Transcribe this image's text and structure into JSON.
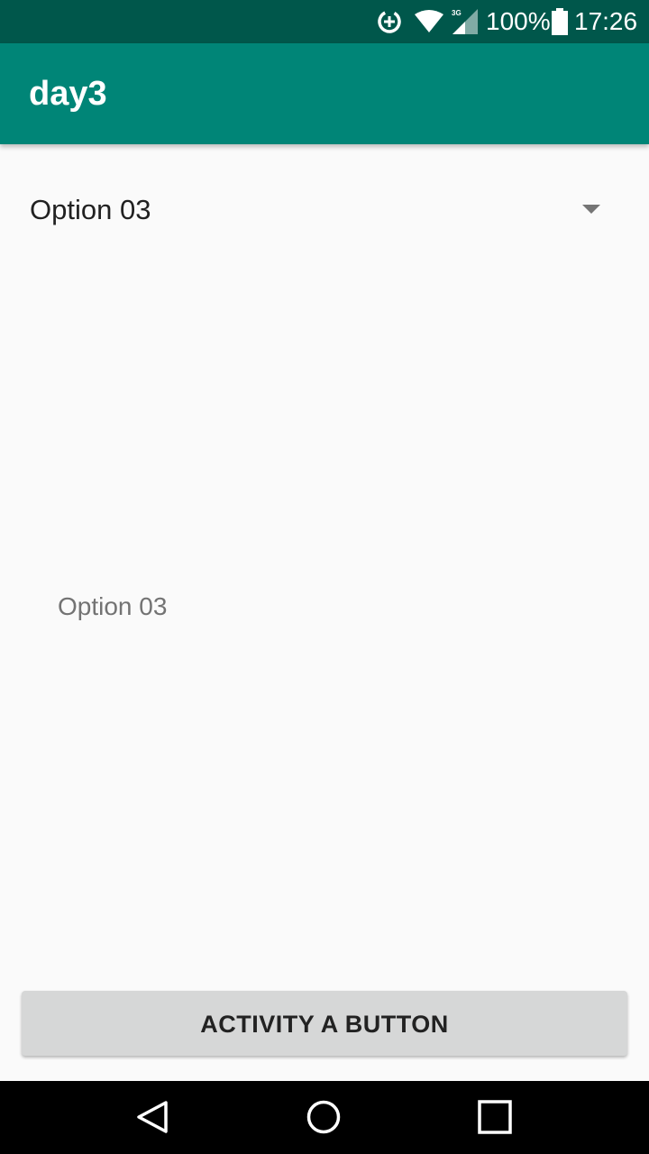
{
  "status_bar": {
    "battery_percent": "100%",
    "time": "17:26",
    "network_type": "3G",
    "icons": [
      "data-saver-icon",
      "wifi-icon",
      "cell-signal-icon",
      "battery-icon"
    ]
  },
  "app_bar": {
    "title": "day3",
    "color": "#008577"
  },
  "spinner": {
    "selected_value": "Option 03"
  },
  "result": {
    "text": "Option 03"
  },
  "button": {
    "label": "ACTIVITY A BUTTON"
  },
  "nav_bar": {
    "icons": [
      "back-icon",
      "home-icon",
      "recents-icon"
    ]
  },
  "colors": {
    "status_bar": "#00574b",
    "primary": "#008577",
    "background": "#fafafa",
    "button": "#d6d7d7"
  }
}
